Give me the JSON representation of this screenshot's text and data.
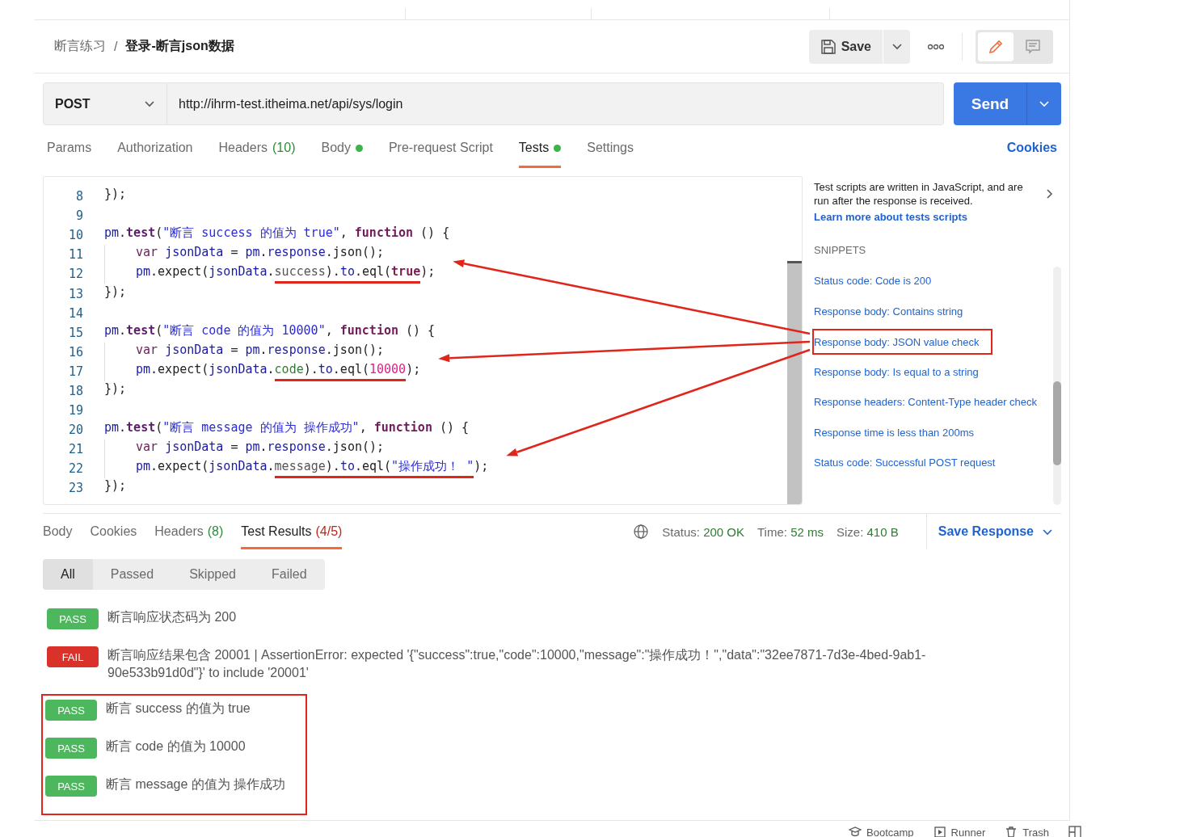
{
  "breadcrumb": {
    "parent": "断言练习",
    "separator": "/",
    "current": "登录-断言json数据"
  },
  "toolbar": {
    "save": "Save",
    "view_toggle": [
      {
        "kind": "edit",
        "selected": true
      },
      {
        "kind": "comment",
        "selected": false
      }
    ]
  },
  "request": {
    "method": "POST",
    "url": "http://ihrm-test.itheima.net/api/sys/login",
    "send": "Send"
  },
  "request_tabs": [
    {
      "label": "Params",
      "selected": false
    },
    {
      "label": "Authorization",
      "selected": false
    },
    {
      "label": "Headers",
      "count": "(10)",
      "selected": false
    },
    {
      "label": "Body",
      "dot": true,
      "selected": false
    },
    {
      "label": "Pre-request Script",
      "selected": false
    },
    {
      "label": "Tests",
      "dot": true,
      "selected": true
    },
    {
      "label": "Settings",
      "selected": false
    }
  ],
  "cookies_link": "Cookies",
  "editor": {
    "lines": [
      {
        "num": "8",
        "tokens": [
          {
            "text": "});",
            "kind": "plain"
          }
        ]
      },
      {
        "num": "9"
      },
      {
        "num": "10",
        "tokens": [
          {
            "text": "pm",
            "kind": "obj"
          },
          {
            "text": ".",
            "kind": "plain"
          },
          {
            "text": "test",
            "kind": "fn"
          },
          {
            "text": "(",
            "kind": "plain"
          },
          {
            "text": "\"断言 success 的值为 true\"",
            "kind": "str"
          },
          {
            "text": ", ",
            "kind": "plain"
          },
          {
            "text": "function",
            "kind": "kw"
          },
          {
            "text": " () {",
            "kind": "plain"
          }
        ]
      },
      {
        "num": "11",
        "indent": true,
        "tokens": [
          {
            "text": "var ",
            "kind": "var"
          },
          {
            "text": "jsonData",
            "kind": "obj"
          },
          {
            "text": " = ",
            "kind": "plain"
          },
          {
            "text": "pm",
            "kind": "obj"
          },
          {
            "text": ".",
            "kind": "plain"
          },
          {
            "text": "response",
            "kind": "obj"
          },
          {
            "text": ".json();",
            "kind": "plain"
          }
        ]
      },
      {
        "num": "12",
        "indent": true,
        "tokens": [
          {
            "text": "pm",
            "kind": "obj"
          },
          {
            "text": ".expect(",
            "kind": "plain"
          },
          {
            "text": "jsonData",
            "kind": "obj"
          },
          {
            "text": ".",
            "kind": "plain"
          },
          {
            "text": "success",
            "kind": "prop",
            "mark": true
          },
          {
            "text": ").",
            "kind": "plain",
            "mark": true
          },
          {
            "text": "to",
            "kind": "obj",
            "mark": true
          },
          {
            "text": ".eql(",
            "kind": "plain",
            "mark": true
          },
          {
            "text": "true",
            "kind": "bool",
            "mark": true
          },
          {
            "text": ");",
            "kind": "plain"
          }
        ]
      },
      {
        "num": "13",
        "tokens": [
          {
            "text": "});",
            "kind": "plain"
          }
        ]
      },
      {
        "num": "14"
      },
      {
        "num": "15",
        "tokens": [
          {
            "text": "pm",
            "kind": "obj"
          },
          {
            "text": ".",
            "kind": "plain"
          },
          {
            "text": "test",
            "kind": "fn"
          },
          {
            "text": "(",
            "kind": "plain"
          },
          {
            "text": "\"断言 code 的值为 10000\"",
            "kind": "str"
          },
          {
            "text": ", ",
            "kind": "plain"
          },
          {
            "text": "function",
            "kind": "kw"
          },
          {
            "text": " () {",
            "kind": "plain"
          }
        ]
      },
      {
        "num": "16",
        "indent": true,
        "tokens": [
          {
            "text": "var ",
            "kind": "var"
          },
          {
            "text": "jsonData",
            "kind": "obj"
          },
          {
            "text": " = ",
            "kind": "plain"
          },
          {
            "text": "pm",
            "kind": "obj"
          },
          {
            "text": ".",
            "kind": "plain"
          },
          {
            "text": "response",
            "kind": "obj"
          },
          {
            "text": ".json();",
            "kind": "plain"
          }
        ]
      },
      {
        "num": "17",
        "indent": true,
        "tokens": [
          {
            "text": "pm",
            "kind": "obj"
          },
          {
            "text": ".expect(",
            "kind": "plain"
          },
          {
            "text": "jsonData",
            "kind": "obj"
          },
          {
            "text": ".",
            "kind": "plain"
          },
          {
            "text": "code",
            "kind": "builtin",
            "mark": true
          },
          {
            "text": ").",
            "kind": "plain",
            "mark": true
          },
          {
            "text": "to",
            "kind": "obj",
            "mark": true
          },
          {
            "text": ".eql(",
            "kind": "plain",
            "mark": true
          },
          {
            "text": "10000",
            "kind": "num",
            "mark": true
          },
          {
            "text": ");",
            "kind": "plain"
          }
        ]
      },
      {
        "num": "18",
        "tokens": [
          {
            "text": "});",
            "kind": "plain"
          }
        ]
      },
      {
        "num": "19"
      },
      {
        "num": "20",
        "tokens": [
          {
            "text": "pm",
            "kind": "obj"
          },
          {
            "text": ".",
            "kind": "plain"
          },
          {
            "text": "test",
            "kind": "fn"
          },
          {
            "text": "(",
            "kind": "plain"
          },
          {
            "text": "\"断言 message 的值为 操作成功\"",
            "kind": "str"
          },
          {
            "text": ", ",
            "kind": "plain"
          },
          {
            "text": "function",
            "kind": "kw"
          },
          {
            "text": " () {",
            "kind": "plain"
          }
        ]
      },
      {
        "num": "21",
        "indent": true,
        "tokens": [
          {
            "text": "var ",
            "kind": "var"
          },
          {
            "text": "jsonData",
            "kind": "obj"
          },
          {
            "text": " = ",
            "kind": "plain"
          },
          {
            "text": "pm",
            "kind": "obj"
          },
          {
            "text": ".",
            "kind": "plain"
          },
          {
            "text": "response",
            "kind": "obj"
          },
          {
            "text": ".json();",
            "kind": "plain"
          }
        ]
      },
      {
        "num": "22",
        "indent": true,
        "tokens": [
          {
            "text": "pm",
            "kind": "obj"
          },
          {
            "text": ".expect(",
            "kind": "plain"
          },
          {
            "text": "jsonData",
            "kind": "obj"
          },
          {
            "text": ".",
            "kind": "plain"
          },
          {
            "text": "message",
            "kind": "prop",
            "mark": true
          },
          {
            "text": ").",
            "kind": "plain",
            "mark": true
          },
          {
            "text": "to",
            "kind": "obj",
            "mark": true
          },
          {
            "text": ".eql(",
            "kind": "plain",
            "mark": true
          },
          {
            "text": "\"操作成功！ \"",
            "kind": "str",
            "mark": true
          },
          {
            "text": ");",
            "kind": "plain"
          }
        ]
      },
      {
        "num": "23",
        "tokens": [
          {
            "text": "});",
            "kind": "plain"
          }
        ]
      }
    ]
  },
  "side_panel": {
    "description": "Test scripts are written in JavaScript, and are run after the response is received.",
    "link": "Learn more about tests scripts",
    "snippets_heading": "SNIPPETS",
    "snippets": [
      {
        "label": "Status code: Code is 200",
        "highlighted": false
      },
      {
        "label": "Response body: Contains string",
        "highlighted": false
      },
      {
        "label": "Response body: JSON value check",
        "highlighted": true
      },
      {
        "label": "Response body: Is equal to a string",
        "highlighted": false
      },
      {
        "label": "Response headers: Content-Type header check",
        "highlighted": false
      },
      {
        "label": "Response time is less than 200ms",
        "highlighted": false
      },
      {
        "label": "Status code: Successful POST request",
        "highlighted": false
      }
    ]
  },
  "response_tabs": [
    {
      "label": "Body",
      "selected": false
    },
    {
      "label": "Cookies",
      "selected": false
    },
    {
      "label": "Headers",
      "count": {
        "text": "(8)",
        "kind": "ok"
      },
      "selected": false
    },
    {
      "label": "Test Results",
      "count": {
        "text": "(4/5)",
        "kind": "error"
      },
      "selected": true
    }
  ],
  "response_meta": [
    {
      "label": "Status:",
      "value": "200 OK"
    },
    {
      "label": "Time:",
      "value": "52 ms"
    },
    {
      "label": "Size:",
      "value": "410 B"
    }
  ],
  "save_response": "Save Response",
  "filters": [
    {
      "label": "All",
      "selected": true
    },
    {
      "label": "Passed",
      "selected": false
    },
    {
      "label": "Skipped",
      "selected": false
    },
    {
      "label": "Failed",
      "selected": false
    }
  ],
  "results": [
    {
      "status": "PASS",
      "kind": "pass",
      "text": "断言响应状态码为 200",
      "boxed": false
    },
    {
      "status": "FAIL",
      "kind": "fail",
      "text": "断言响应结果包含 20001 | AssertionError: expected '{\"success\":true,\"code\":10000,\"message\":\"操作成功！\",\"data\":\"32ee7871-7d3e-4bed-9ab1-90e533b91d0d\"}' to include '20001'",
      "boxed": false
    },
    {
      "status": "PASS",
      "kind": "pass",
      "text": "断言 success 的值为 true",
      "boxed": true
    },
    {
      "status": "PASS",
      "kind": "pass",
      "text": "断言 code 的值为 10000",
      "boxed": true
    },
    {
      "status": "PASS",
      "kind": "pass",
      "text": "断言 message 的值为 操作成功",
      "boxed": true
    }
  ],
  "footer": [
    {
      "label": "Bootcamp",
      "kind": "bootcamp"
    },
    {
      "label": "Runner",
      "kind": "runner"
    },
    {
      "label": "Trash",
      "kind": "trash"
    }
  ]
}
